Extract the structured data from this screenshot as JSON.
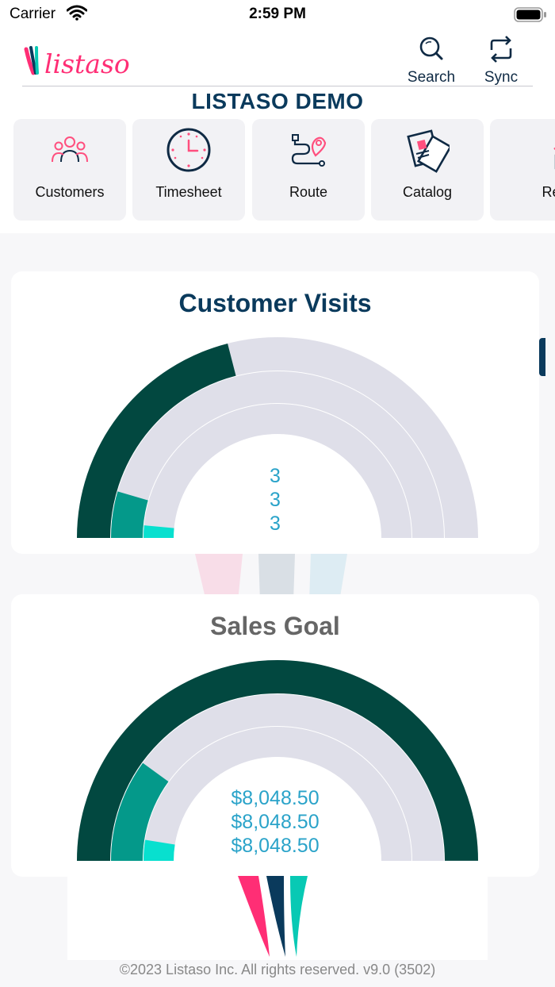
{
  "status_bar": {
    "carrier": "Carrier",
    "time": "2:59 PM"
  },
  "header": {
    "logo_text": "listaso",
    "search_label": "Search",
    "sync_label": "Sync",
    "title": "LISTASO DEMO"
  },
  "tiles": [
    {
      "label": "Customers",
      "icon": "users-icon"
    },
    {
      "label": "Timesheet",
      "icon": "clock-icon"
    },
    {
      "label": "Route",
      "icon": "route-icon"
    },
    {
      "label": "Catalog",
      "icon": "catalog-icon"
    },
    {
      "label": "Repo",
      "icon": "reports-icon"
    }
  ],
  "visits": {
    "title": "Customer Visits",
    "values": [
      "3",
      "3",
      "3"
    ],
    "fractions": [
      0.42,
      0.09,
      0.03
    ]
  },
  "sales": {
    "title": "Sales Goal",
    "values": [
      "$8,048.50",
      "$8,048.50",
      "$8,048.50"
    ],
    "fractions": [
      1.0,
      0.2,
      0.05
    ]
  },
  "colors": {
    "ring_outer": "#024840",
    "ring_middle": "#04998a",
    "ring_inner": "#08e0cf",
    "track": "#dfdfe9",
    "title_navy": "#0a3a5c",
    "value_blue": "#2aa3c9",
    "brand_pink": "#ff2e75",
    "brand_teal": "#08c9b4"
  },
  "footer": "©2023 Listaso Inc. All rights reserved.  v9.0 (3502)"
}
